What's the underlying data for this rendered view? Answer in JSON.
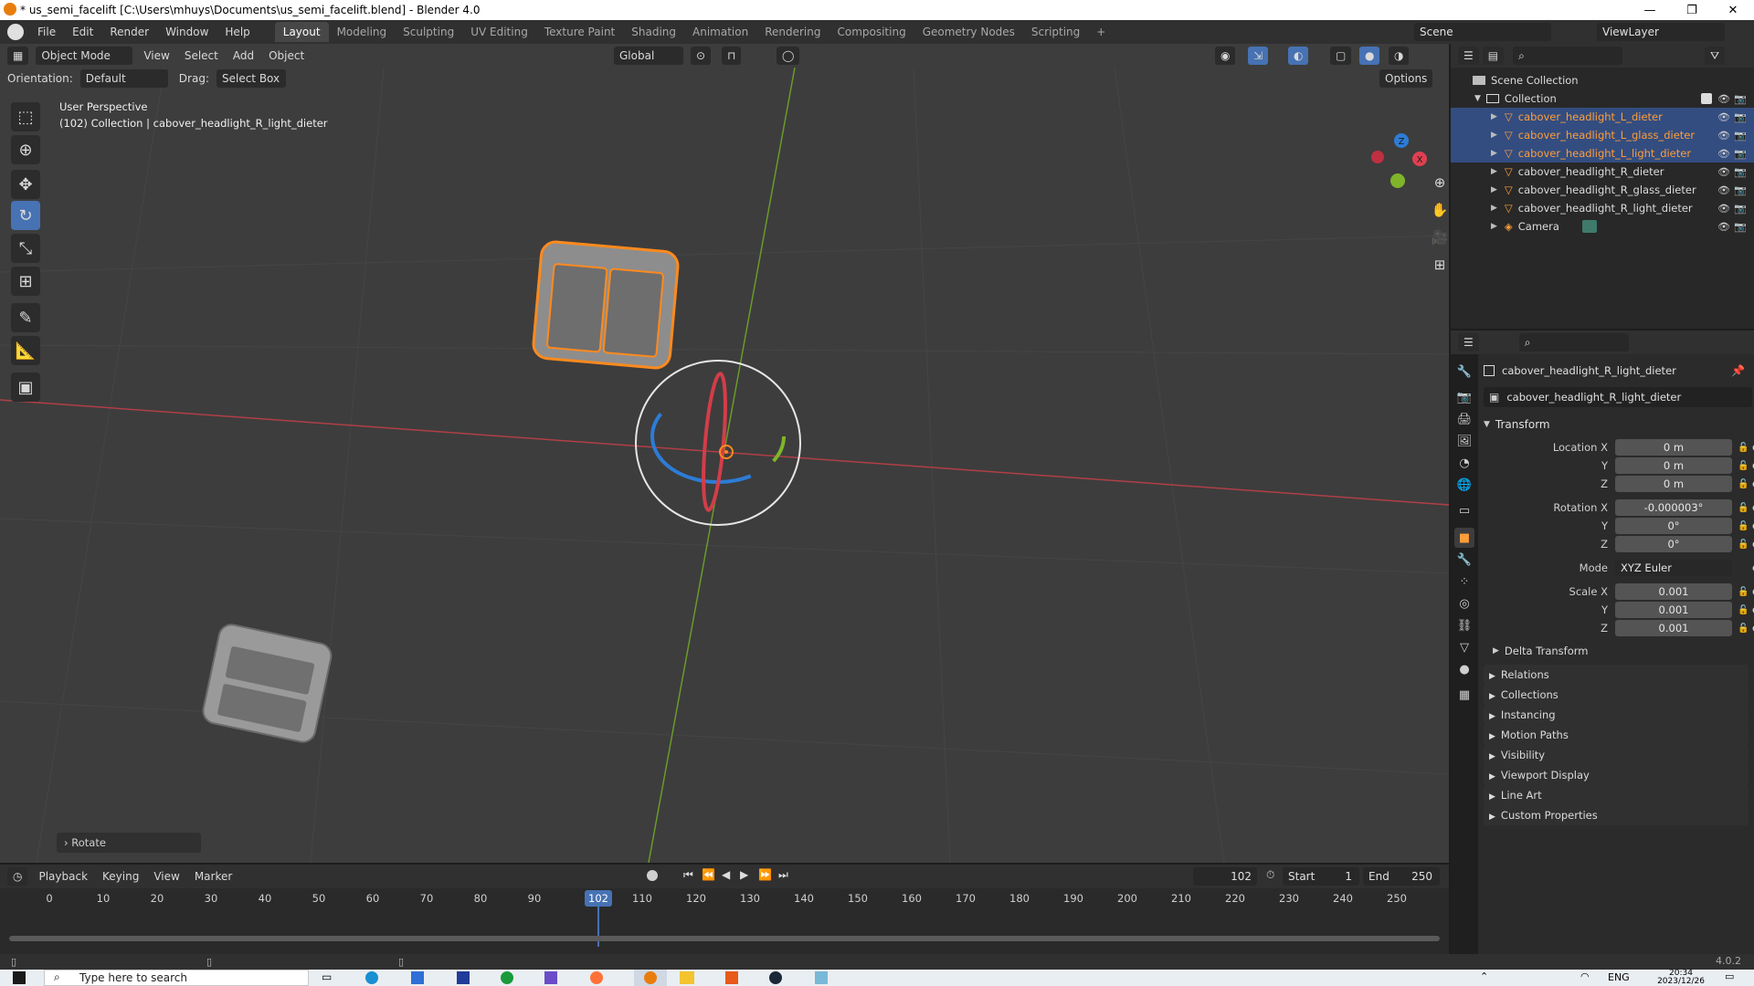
{
  "window": {
    "title": "* us_semi_facelift [C:\\Users\\mhuys\\Documents\\us_semi_facelift.blend] - Blender 4.0",
    "minimize": "—",
    "maximize": "❐",
    "close": "✕"
  },
  "menus": [
    "File",
    "Edit",
    "Render",
    "Window",
    "Help"
  ],
  "workspaces": [
    "Layout",
    "Modeling",
    "Sculpting",
    "UV Editing",
    "Texture Paint",
    "Shading",
    "Animation",
    "Rendering",
    "Compositing",
    "Geometry Nodes",
    "Scripting"
  ],
  "active_workspace": "Layout",
  "add_workspace": "+",
  "scene": "Scene",
  "view_layer": "ViewLayer",
  "viewport": {
    "mode": "Object Mode",
    "menus": [
      "View",
      "Select",
      "Add",
      "Object"
    ],
    "transform_orientation": "Global",
    "orientation_label": "Orientation:",
    "orientation_value": "Default",
    "drag_label": "Drag:",
    "drag_value": "Select Box",
    "options": "Options",
    "overlay_line1": "User Perspective",
    "overlay_line2": "(102) Collection | cabover_headlight_R_light_dieter",
    "last_operator": "Rotate",
    "gizmo_axes": [
      "Z",
      "X"
    ]
  },
  "outliner": {
    "root": "Scene Collection",
    "collection": "Collection",
    "items": [
      {
        "name": "cabover_headlight_L_dieter",
        "selected": true
      },
      {
        "name": "cabover_headlight_L_glass_dieter",
        "selected": true
      },
      {
        "name": "cabover_headlight_L_light_dieter",
        "selected": true
      },
      {
        "name": "cabover_headlight_R_dieter",
        "selected": false
      },
      {
        "name": "cabover_headlight_R_glass_dieter",
        "selected": false
      },
      {
        "name": "cabover_headlight_R_light_dieter",
        "selected": false
      },
      {
        "name": "Camera",
        "selected": false
      }
    ]
  },
  "properties": {
    "object_name": "cabover_headlight_R_light_dieter",
    "datablock": "cabover_headlight_R_light_dieter",
    "transform_header": "Transform",
    "location": {
      "label": "Location X",
      "x": "0 m",
      "y": "0 m",
      "z": "0 m"
    },
    "rotation": {
      "label": "Rotation X",
      "x": "-0.000003°",
      "y": "0°",
      "z": "0°"
    },
    "mode_label": "Mode",
    "mode_value": "XYZ Euler",
    "scale": {
      "label": "Scale X",
      "x": "0.001",
      "y": "0.001",
      "z": "0.001"
    },
    "axis_y": "Y",
    "axis_z": "Z",
    "delta": "Delta Transform",
    "panels": [
      "Relations",
      "Collections",
      "Instancing",
      "Motion Paths",
      "Visibility",
      "Viewport Display",
      "Line Art",
      "Custom Properties"
    ]
  },
  "timeline": {
    "menus": [
      "Playback",
      "Keying",
      "View",
      "Marker"
    ],
    "current_frame": "102",
    "start_label": "Start",
    "start": "1",
    "end_label": "End",
    "end": "250",
    "ticks": [
      "0",
      "10",
      "20",
      "30",
      "40",
      "50",
      "60",
      "70",
      "80",
      "90",
      "110",
      "120",
      "130",
      "140",
      "150",
      "160",
      "170",
      "180",
      "190",
      "200",
      "210",
      "220",
      "230",
      "240",
      "250"
    ]
  },
  "status": {
    "version": "4.0.2"
  },
  "taskbar": {
    "search_placeholder": "Type here to search",
    "time": "20:34",
    "date": "2023/12/26",
    "lang": "ENG"
  }
}
